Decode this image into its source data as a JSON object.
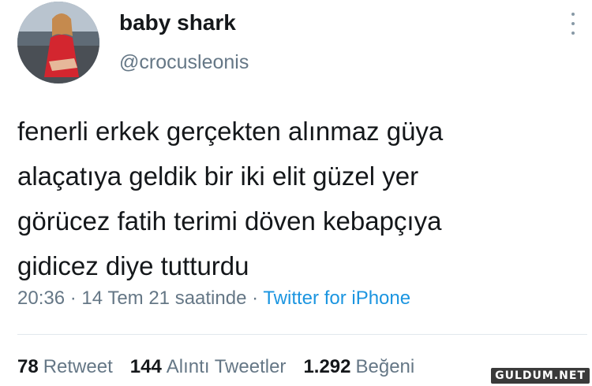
{
  "user": {
    "display_name": "baby shark",
    "handle": "@crocusleonis",
    "avatar": "profile-photo"
  },
  "more_icon": "more-vertical-icon",
  "tweet": {
    "lines": [
      "fenerli erkek gerçekten alınmaz güya",
      "alaçatıya geldik bir iki elit güzel yer",
      "görücez fatih terimi döven kebapçıya",
      "gidicez diye tutturdu"
    ]
  },
  "meta": {
    "time": "20:36",
    "separator": " · ",
    "date": "14 Tem 21 saatinde",
    "source": "Twitter for iPhone"
  },
  "stats": {
    "retweets_count": "78",
    "retweets_label": "Retweet",
    "quotes_count": "144",
    "quotes_label": "Alıntı Tweetler",
    "likes_count": "1.292",
    "likes_label": "Beğeni"
  },
  "watermark": "GULDUM.NET",
  "colors": {
    "text": "#14171a",
    "secondary": "#657786",
    "link": "#1b95e0",
    "divider": "#e1e8ed"
  }
}
